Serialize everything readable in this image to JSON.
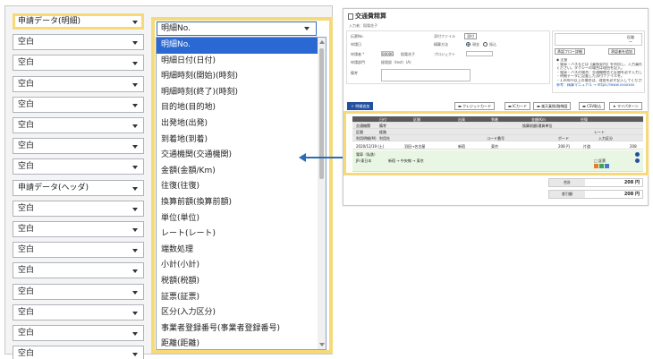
{
  "left_panel": {
    "rows": [
      {
        "label": "申請データ(明細)",
        "highlight": true
      },
      {
        "label": "空白"
      },
      {
        "label": "空白"
      },
      {
        "label": "空白"
      },
      {
        "label": "空白"
      },
      {
        "label": "空白"
      },
      {
        "label": "空白"
      },
      {
        "label": "空白"
      },
      {
        "label": "申請データ(ヘッダ)"
      },
      {
        "label": "空白"
      },
      {
        "label": "空白"
      },
      {
        "label": "空白"
      },
      {
        "label": "空白"
      },
      {
        "label": "空白"
      },
      {
        "label": "空白"
      },
      {
        "label": "空白"
      },
      {
        "label": "空白"
      }
    ],
    "dropdown": {
      "selected": "明細No.",
      "options": [
        "明細No.",
        "明細日付(日付)",
        "明細時刻(開始)(時刻)",
        "明細時刻(終了)(時刻)",
        "目的地(目的地)",
        "出発地(出発)",
        "到着地(到着)",
        "交通機関(交通機関)",
        "金額(金額/Km)",
        "往復(往復)",
        "換算前額(換算前額)",
        "単位(単位)",
        "レート(レート)",
        "端数処理",
        "小計(小計)",
        "税額(税額)",
        "証票(証票)",
        "区分(入力区分)",
        "事業者登録番号(事業者登録番号)",
        "距離(距離)"
      ]
    }
  },
  "app": {
    "title": "交通費精算",
    "subtitle": "入力者：稲電花子",
    "form": {
      "labels": [
        "伝票No.",
        "申請日",
        "申請者 *",
        "申請部門",
        "備考"
      ],
      "values": {
        "applicant_code": "00000",
        "applicant_name": "稲電花子",
        "dept": "経理部（test）(A)"
      },
      "right_labels": [
        "添付ファイル",
        "精算方法",
        "プロジェクト"
      ],
      "attach_btn": "添付",
      "radio": [
        "現金",
        "振込"
      ]
    },
    "side": {
      "cells": [
        "",
        "",
        "",
        "役職"
      ],
      "vals": [
        "",
        "",
        "",
        "ー"
      ],
      "buttons": [
        "承認フロー詳細",
        "承認者を追加"
      ],
      "notes": [
        "◆ 注意",
        "・電車・バスなどは【乗換案内】を利用し、入力漏れのないようにして",
        "ください。タクシーの場合は理由を記入。",
        "・電車・バスの場合：交通機関名と区間を必ず入力してください。明細を作成",
        "・明細データに記載した添付ファイルを。",
        "・1,000円以上の場合は、理由を必ず記入してください。"
      ],
      "link": "参考：精算マニュアル → https://www.xxxxxxx"
    },
    "toolbar": {
      "add": "＋ 明細追加",
      "buttons": [
        "クレジットカード",
        "ICカード",
        "楽天乗換/路線図",
        "CSV取込",
        "マイパターン"
      ]
    },
    "table": {
      "header1": [
        "",
        "日付",
        "区間",
        "出発",
        "到着",
        "金額/Km",
        "往復"
      ],
      "header2": [
        "交通機関",
        "備考",
        "",
        "",
        "",
        "換算前額/通貨単位",
        ""
      ],
      "header3": [
        "区間",
        "経路",
        "",
        "",
        "",
        "レート",
        ""
      ],
      "header4": [
        "利用明細(M)",
        "利用先",
        "",
        "コード番号",
        "",
        "ボード",
        "入力区分"
      ],
      "row": {
        "date": "2020/12/19 (土)",
        "route": "羽田→名古屋",
        "from": "新宿",
        "to": "東京",
        "amount": "208",
        "unit": "円",
        "roundtrip": "片道",
        "total": "208"
      },
      "row2": {
        "col1": "電車（私鉄）",
        "col2": "JR-東日本",
        "col3": "新宿 → 中央線 → 東京",
        "col4": "□ 証票"
      }
    },
    "totals": [
      {
        "key": "合計",
        "value": "208 円"
      },
      {
        "key": "差引額",
        "value": "208 円"
      }
    ]
  },
  "colors": {
    "highlight": "#f6da7a",
    "accent": "#2a68d4",
    "arrow": "#2b6cb6"
  }
}
